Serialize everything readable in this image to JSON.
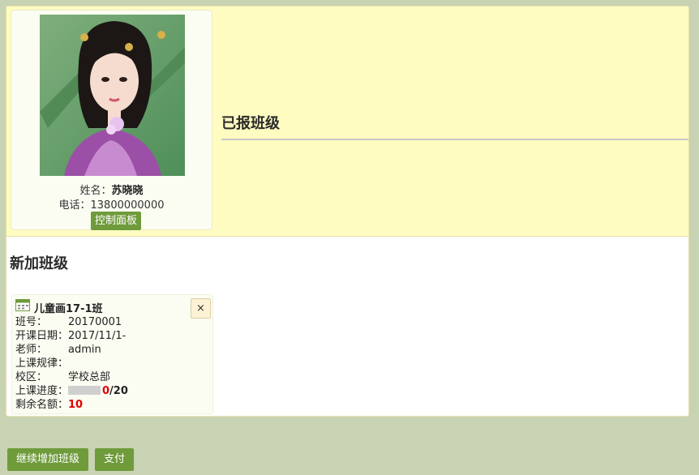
{
  "profile": {
    "avatar_alt": "student-portrait",
    "name_label": "姓名：",
    "name_value": "苏晓晓",
    "phone_label": "电话：",
    "phone_value": "13800000000",
    "control_button": "控制面板"
  },
  "enrolled": {
    "title": "已报班级"
  },
  "new_classes": {
    "title": "新加班级",
    "cards": [
      {
        "icon": "calendar-icon",
        "name": "儿童画17-1班",
        "close_symbol": "×",
        "class_no_label": "班号：",
        "class_no": "20170001",
        "start_date_label": "开课日期：",
        "start_date": "2017/11/1-",
        "teacher_label": "老师：",
        "teacher": "admin",
        "schedule_label": "上课规律：",
        "schedule": "",
        "campus_label": "校区：",
        "campus": "学校总部",
        "progress_label": "上课进度：",
        "progress_done": "0",
        "progress_total": "/20",
        "progress_fraction": 0,
        "remaining_label": "剩余名额：",
        "remaining": "10"
      }
    ]
  },
  "footer": {
    "add_more_button": "继续增加班级",
    "pay_button": "支付"
  },
  "colors": {
    "page_bg": "#c7d3b2",
    "top_section_bg": "#fffcc2",
    "accent_green": "#6f9b3b",
    "highlight_red": "#e10000"
  }
}
